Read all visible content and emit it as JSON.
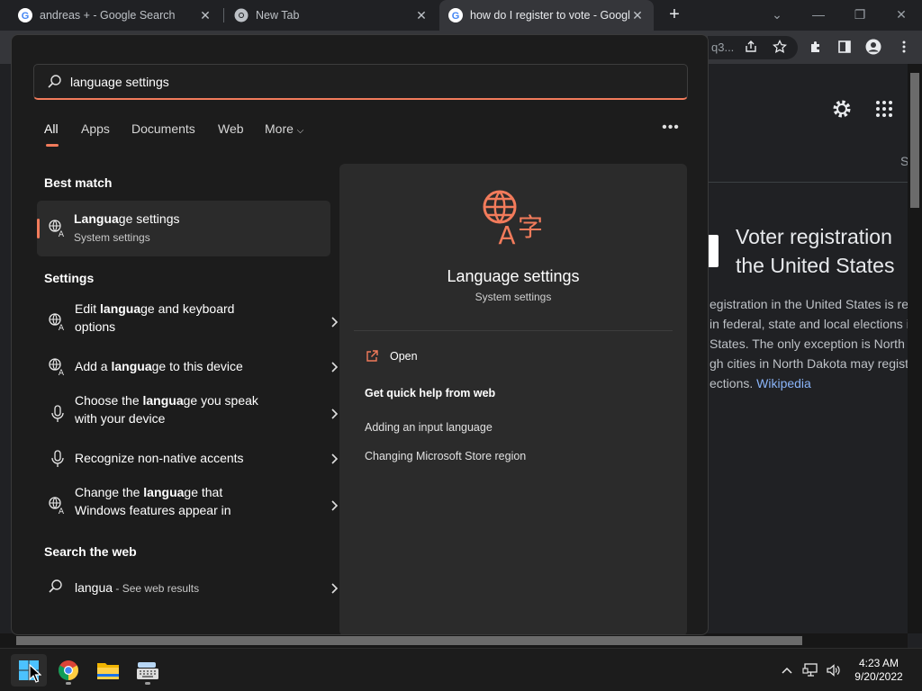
{
  "browser": {
    "tabs": [
      {
        "title": "andreas + - Google Search",
        "favicon": "google-g-icon"
      },
      {
        "title": "New Tab",
        "favicon": "chrome-icon"
      },
      {
        "title": "how do I register to vote - Google Search",
        "favicon": "google-g-icon",
        "active": true
      }
    ],
    "new_tab_label": "+",
    "omnibox_tail": "q3..."
  },
  "google_page": {
    "panel_title": "Voter registration in the United States",
    "panel_title_lines": [
      "Voter registration",
      "the United States"
    ],
    "description_lines": [
      "egistration in the United States is re",
      "in federal, state and local elections i",
      "States. The only exception is North",
      "gh cities in North Dakota may registe",
      "ections."
    ],
    "source_link": "Wikipedia",
    "header_fragment": "S"
  },
  "search_panel": {
    "query": "language settings",
    "filters": [
      "All",
      "Apps",
      "Documents",
      "Web",
      "More"
    ],
    "active_filter": "All",
    "more_options_icon": "ellipsis-icon",
    "best_match": {
      "section_title": "Best match",
      "title_bold": "Langua",
      "title_rest": "ge settings",
      "subtitle": "System settings"
    },
    "settings": {
      "section_title": "Settings",
      "items": [
        {
          "pre": "Edit ",
          "bold": "langua",
          "post": "ge and keyboard",
          "line2": "options",
          "icon": "language-icon"
        },
        {
          "pre": "Add a ",
          "bold": "langua",
          "post": "ge to this device",
          "line2": "",
          "icon": "language-icon"
        },
        {
          "pre": "Choose the ",
          "bold": "langua",
          "post": "ge you speak",
          "line2": "with your device",
          "icon": "microphone-icon"
        },
        {
          "pre": "Recognize non-native accents",
          "bold": "",
          "post": "",
          "line2": "",
          "icon": "microphone-icon"
        },
        {
          "pre": "Change the ",
          "bold": "langua",
          "post": "ge that",
          "line2": "Windows features appear in",
          "icon": "language-icon"
        }
      ]
    },
    "web": {
      "section_title": "Search the web",
      "query": "langua",
      "suffix": " - See web results"
    },
    "preview": {
      "title": "Language settings",
      "subtitle": "System settings",
      "open_label": "Open",
      "help_title": "Get quick help from web",
      "links": [
        "Adding an input language",
        "Changing Microsoft Store region"
      ]
    }
  },
  "taskbar": {
    "apps": [
      "start-icon",
      "chrome-icon",
      "file-explorer-icon",
      "on-screen-keyboard-icon"
    ],
    "time": "4:23 AM",
    "date": "9/20/2022"
  },
  "colors": {
    "accent": "#f27b5b",
    "link": "#8ab4f8",
    "panel_bg": "#1c1c1c",
    "card_bg": "#2b2b2b"
  }
}
